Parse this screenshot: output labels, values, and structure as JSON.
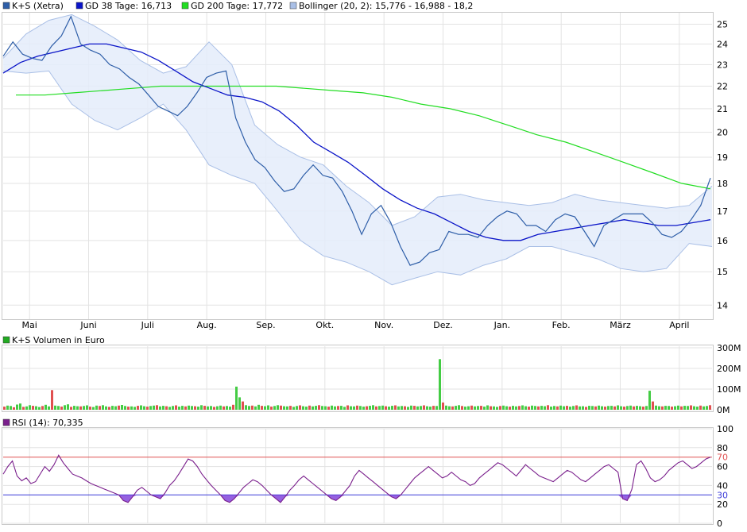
{
  "chart_data": [
    {
      "type": "line",
      "legend": [
        {
          "label": "K+S (Xetra)",
          "color": "#2e5ea8"
        },
        {
          "label": "GD 38 Tage: 16,713",
          "color": "#0a14c8"
        },
        {
          "label": "GD 200 Tage: 17,772",
          "color": "#22dd22"
        },
        {
          "label": "Bollinger (20, 2): 15,776 - 16,988 - 18,2",
          "color": "#a9bfe6"
        }
      ],
      "x_months": [
        "Mai",
        "Juni",
        "Juli",
        "Aug.",
        "Sep.",
        "Okt.",
        "Nov.",
        "Dez.",
        "Jan.",
        "Feb.",
        "März",
        "April"
      ],
      "y_ticks": [
        "25",
        "24",
        "23",
        "22",
        "21",
        "20",
        "19",
        "18",
        "17",
        "16",
        "15",
        "14"
      ],
      "ylim": [
        13.6,
        25.6
      ],
      "y_scale": "log",
      "grid": true,
      "series": [
        {
          "name": "K+S (Xetra)",
          "values": [
            23.4,
            24.1,
            23.5,
            23.3,
            23.2,
            23.9,
            24.4,
            25.4,
            24.0,
            23.7,
            23.5,
            23.0,
            22.8,
            22.4,
            22.1,
            21.6,
            21.1,
            20.9,
            20.7,
            21.1,
            21.7,
            22.4,
            22.6,
            22.7,
            20.6,
            19.6,
            18.9,
            18.6,
            18.1,
            17.7,
            17.8,
            18.3,
            18.7,
            18.3,
            18.2,
            17.7,
            17.0,
            16.2,
            16.9,
            17.2,
            16.6,
            15.8,
            15.2,
            15.3,
            15.6,
            15.7,
            16.3,
            16.2,
            16.2,
            16.1,
            16.5,
            16.8,
            17.0,
            16.9,
            16.5,
            16.5,
            16.3,
            16.7,
            16.9,
            16.8,
            16.3,
            15.8,
            16.5,
            16.7,
            16.9,
            16.9,
            16.9,
            16.6,
            16.2,
            16.1,
            16.3,
            16.7,
            17.2,
            18.2
          ]
        },
        {
          "name": "GD 38 Tage: 16,713",
          "values": [
            22.6,
            23.1,
            23.4,
            23.6,
            23.8,
            24.0,
            24.0,
            23.8,
            23.6,
            23.2,
            22.7,
            22.2,
            21.9,
            21.6,
            21.5,
            21.3,
            20.9,
            20.3,
            19.6,
            19.2,
            18.8,
            18.3,
            17.8,
            17.4,
            17.1,
            16.9,
            16.6,
            16.3,
            16.1,
            16.0,
            16.0,
            16.2,
            16.3,
            16.4,
            16.5,
            16.6,
            16.7,
            16.6,
            16.5,
            16.5,
            16.6,
            16.7
          ]
        },
        {
          "name": "GD 200 Tage: 17,772",
          "values": [
            21.6,
            21.6,
            21.7,
            21.8,
            21.9,
            22.0,
            22.0,
            22.0,
            22.0,
            22.0,
            21.9,
            21.8,
            21.7,
            21.5,
            21.2,
            21.0,
            20.7,
            20.3,
            19.9,
            19.6,
            19.2,
            18.8,
            18.4,
            18.0,
            17.8
          ]
        },
        {
          "name": "Bollinger (20, 2): 15,776 - 16,988 - 18,2",
          "upper": [
            23.3,
            24.5,
            25.2,
            25.5,
            24.9,
            24.2,
            23.2,
            22.6,
            22.9,
            24.1,
            23.0,
            20.3,
            19.5,
            19.0,
            18.7,
            17.9,
            17.3,
            16.5,
            16.8,
            17.5,
            17.6,
            17.4,
            17.3,
            17.2,
            17.3,
            17.6,
            17.4,
            17.3,
            17.2,
            17.1,
            17.2,
            17.9
          ],
          "lower": [
            22.7,
            22.6,
            22.7,
            21.2,
            20.5,
            20.1,
            20.6,
            21.2,
            20.1,
            18.7,
            18.3,
            18.0,
            17.0,
            16.0,
            15.5,
            15.3,
            15.0,
            14.6,
            14.8,
            15.0,
            14.9,
            15.2,
            15.4,
            15.8,
            15.8,
            15.6,
            15.4,
            15.1,
            15.0,
            15.1,
            15.9,
            15.8
          ]
        }
      ]
    },
    {
      "type": "bar",
      "legend": [
        {
          "label": "K+S Volumen in Euro",
          "color": "#22aa22"
        }
      ],
      "y_ticks": [
        "300M",
        "200M",
        "100M",
        "0M"
      ],
      "ylim": [
        0,
        300
      ],
      "grid": true,
      "series": [
        {
          "name": "K+S Volumen in Euro",
          "unit": "M",
          "values": [
            15,
            20,
            18,
            12,
            25,
            30,
            14,
            16,
            22,
            19,
            17,
            13,
            18,
            24,
            16,
            95,
            20,
            18,
            15,
            22,
            26,
            14,
            19,
            17,
            16,
            18,
            21,
            15,
            13,
            20,
            18,
            22,
            16,
            14,
            19,
            17,
            20,
            23,
            18,
            15,
            16,
            14,
            19,
            21,
            17,
            15,
            18,
            20,
            22,
            16,
            19,
            17,
            14,
            18,
            21,
            15,
            19,
            16,
            20,
            18,
            17,
            15,
            22,
            19,
            16,
            18,
            14,
            17,
            20,
            16,
            18,
            15,
            24,
            112,
            60,
            40,
            22,
            18,
            20,
            16,
            24,
            19,
            17,
            21,
            15,
            18,
            22,
            20,
            17,
            16,
            19,
            14,
            18,
            21,
            17,
            15,
            20,
            16,
            19,
            22,
            18,
            17,
            15,
            20,
            16,
            18,
            19,
            14,
            21,
            17,
            16,
            20,
            18,
            15,
            17,
            19,
            22,
            16,
            18,
            20,
            17,
            15,
            19,
            21,
            16,
            18,
            17,
            14,
            20,
            19,
            16,
            18,
            21,
            17,
            15,
            19,
            18,
            245,
            35,
            20,
            17,
            16,
            19,
            22,
            18,
            15,
            17,
            20,
            16,
            18,
            19,
            15,
            21,
            17,
            16,
            14,
            18,
            20,
            17,
            15,
            19,
            16,
            18,
            21,
            17,
            15,
            20,
            18,
            16,
            19,
            17,
            22,
            15,
            18,
            16,
            20,
            17,
            19,
            15,
            18,
            21,
            16,
            17,
            14,
            19,
            18,
            16,
            20,
            17,
            15,
            18,
            19,
            16,
            21,
            17,
            15,
            18,
            20,
            16,
            19,
            17,
            15,
            18,
            92,
            40,
            20,
            17,
            16,
            19,
            18,
            15,
            17,
            20,
            16,
            19,
            18,
            21,
            17,
            15,
            20,
            16,
            18,
            22
          ]
        }
      ]
    },
    {
      "type": "line",
      "legend": [
        {
          "label": "RSI (14): 70,335",
          "color": "#7a1f8c"
        }
      ],
      "y_ticks": [
        "100",
        "80",
        "60",
        "40",
        "20",
        "0"
      ],
      "ylim": [
        0,
        100
      ],
      "reference_lines": [
        {
          "label": "70",
          "value": 70,
          "color": "#e05050"
        },
        {
          "label": "30",
          "value": 30,
          "color": "#3a3ad8"
        }
      ],
      "grid": true,
      "series": [
        {
          "name": "RSI (14): 70,335",
          "values": [
            52,
            60,
            66,
            50,
            45,
            48,
            42,
            44,
            52,
            60,
            55,
            62,
            72,
            64,
            58,
            52,
            50,
            48,
            45,
            42,
            40,
            38,
            36,
            34,
            32,
            30,
            24,
            22,
            28,
            35,
            38,
            34,
            30,
            28,
            26,
            32,
            40,
            45,
            52,
            60,
            68,
            66,
            60,
            52,
            46,
            40,
            35,
            30,
            24,
            22,
            26,
            32,
            38,
            42,
            46,
            44,
            40,
            35,
            30,
            26,
            22,
            28,
            35,
            40,
            46,
            50,
            46,
            42,
            38,
            34,
            30,
            26,
            24,
            28,
            34,
            40,
            50,
            56,
            52,
            48,
            44,
            40,
            36,
            32,
            28,
            26,
            30,
            36,
            42,
            48,
            52,
            56,
            60,
            56,
            52,
            48,
            50,
            54,
            50,
            46,
            44,
            40,
            42,
            48,
            52,
            56,
            60,
            64,
            62,
            58,
            54,
            50,
            56,
            62,
            58,
            54,
            50,
            48,
            46,
            44,
            48,
            52,
            56,
            54,
            50,
            46,
            44,
            48,
            52,
            56,
            60,
            62,
            58,
            54,
            26,
            24,
            36,
            62,
            66,
            58,
            48,
            44,
            46,
            50,
            56,
            60,
            64,
            66,
            62,
            58,
            60,
            64,
            68,
            70
          ]
        }
      ]
    }
  ]
}
